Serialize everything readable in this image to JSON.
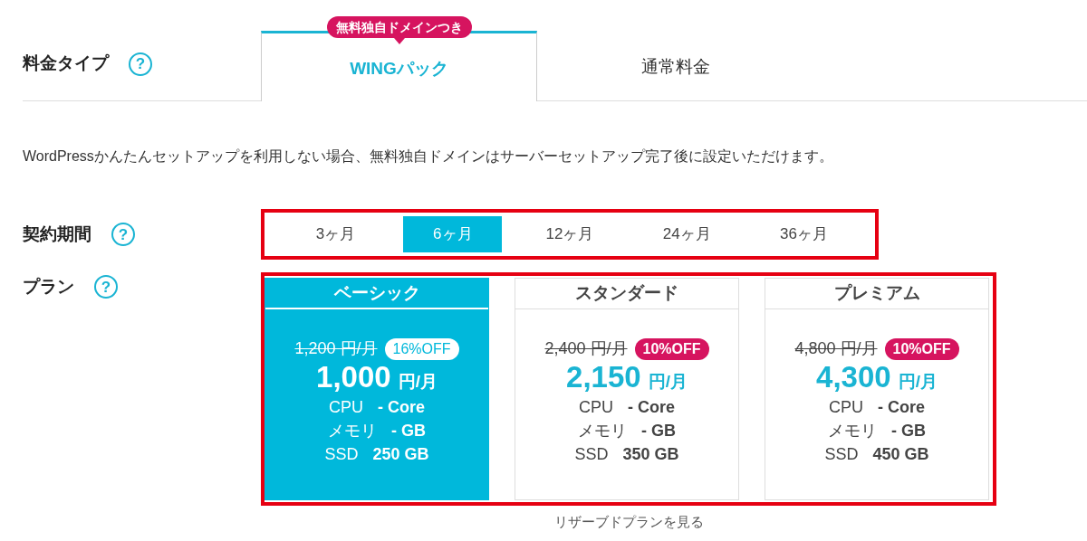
{
  "type_row": {
    "label": "料金タイプ",
    "help": "?",
    "tabs": [
      {
        "label": "WINGパック",
        "selected": true,
        "ribbon": "無料独自ドメインつき"
      },
      {
        "label": "通常料金",
        "selected": false
      }
    ]
  },
  "note": "WordPressかんたんセットアップを利用しない場合、無料独自ドメインはサーバーセットアップ完了後に設定いただけます。",
  "period_row": {
    "label": "契約期間",
    "help": "?",
    "options": [
      {
        "label": "3ヶ月",
        "selected": false
      },
      {
        "label": "6ヶ月",
        "selected": true
      },
      {
        "label": "12ヶ月",
        "selected": false
      },
      {
        "label": "24ヶ月",
        "selected": false
      },
      {
        "label": "36ヶ月",
        "selected": false
      }
    ]
  },
  "plan_row": {
    "label": "プラン",
    "help": "?",
    "plans": [
      {
        "name": "ベーシック",
        "selected": true,
        "old_price": "1,200 円/月",
        "discount": "16%OFF",
        "price": "1,000",
        "unit": "円/月",
        "specs": [
          [
            "CPU",
            "- Core"
          ],
          [
            "メモリ",
            "- GB"
          ],
          [
            "SSD",
            "250 GB"
          ]
        ]
      },
      {
        "name": "スタンダード",
        "selected": false,
        "old_price": "2,400 円/月",
        "discount": "10%OFF",
        "price": "2,150",
        "unit": "円/月",
        "specs": [
          [
            "CPU",
            "- Core"
          ],
          [
            "メモリ",
            "- GB"
          ],
          [
            "SSD",
            "350 GB"
          ]
        ]
      },
      {
        "name": "プレミアム",
        "selected": false,
        "old_price": "4,800 円/月",
        "discount": "10%OFF",
        "price": "4,300",
        "unit": "円/月",
        "specs": [
          [
            "CPU",
            "- Core"
          ],
          [
            "メモリ",
            "- GB"
          ],
          [
            "SSD",
            "450 GB"
          ]
        ]
      }
    ]
  },
  "more_link": "リザーブドプランを見る"
}
